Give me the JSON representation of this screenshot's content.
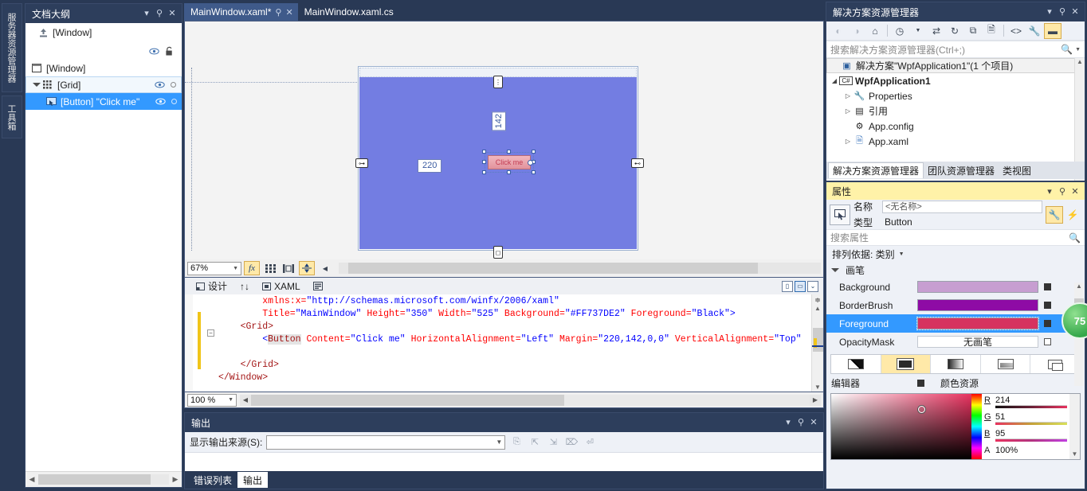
{
  "left_dock": {
    "tabs": [
      {
        "label": "服务器资源管理器",
        "name": "server-explorer"
      },
      {
        "label": "工具箱",
        "name": "toolbox"
      }
    ]
  },
  "document_outline": {
    "title": "文档大纲",
    "window_header": "[Window]",
    "rows": [
      {
        "label": "[Window]",
        "icon": "window-icon",
        "indent": 0
      },
      {
        "label": "[Grid]",
        "icon": "grid-icon",
        "indent": 1
      },
      {
        "label": "[Button] \"Click me\"",
        "icon": "button-icon",
        "indent": 2
      }
    ]
  },
  "editor_tabs": [
    {
      "label": "MainWindow.xaml*",
      "active": true,
      "dirty": true
    },
    {
      "label": "MainWindow.xaml.cs",
      "active": false,
      "dirty": false
    }
  ],
  "designer": {
    "zoom": "67%",
    "margin_left_chip": "220",
    "margin_top_chip": "142",
    "button_content": "Click me",
    "window_background": "#737DE2",
    "buttons": {
      "fx": "fx",
      "grid_rulers": "grid-icon",
      "snap": "snap-icon",
      "effects": "effects-icon"
    }
  },
  "split_bar": {
    "design_label": "设计",
    "swap_label": "swap-icon",
    "xaml_label": "XAML",
    "props_label": "props-icon"
  },
  "code": {
    "zoom": "100 %",
    "lines": [
      {
        "indent": 8,
        "parts": [
          {
            "t": "xmlns:x=",
            "c": "attr"
          },
          {
            "t": "\"http://schemas.microsoft.com/winfx/2006/xaml\"",
            "c": "val"
          }
        ]
      },
      {
        "indent": 8,
        "parts": [
          {
            "t": "Title=",
            "c": "attr"
          },
          {
            "t": "\"MainWindow\"",
            "c": "val"
          },
          {
            "t": " Height=",
            "c": "attr"
          },
          {
            "t": "\"350\"",
            "c": "val"
          },
          {
            "t": " Width=",
            "c": "attr"
          },
          {
            "t": "\"525\"",
            "c": "val"
          },
          {
            "t": " Background=",
            "c": "attr"
          },
          {
            "t": "\"#FF737DE2\"",
            "c": "val"
          },
          {
            "t": " Foreground=",
            "c": "attr"
          },
          {
            "t": "\"Black\"",
            "c": "val"
          },
          {
            "t": ">",
            "c": "brk"
          }
        ]
      },
      {
        "indent": 4,
        "parts": [
          {
            "t": "<Grid>",
            "c": "tag"
          }
        ]
      },
      {
        "indent": 8,
        "parts": [
          {
            "t": "<",
            "c": "brk"
          },
          {
            "t": "Button",
            "c": "el"
          },
          {
            "t": " Content=",
            "c": "attr"
          },
          {
            "t": "\"Click me\"",
            "c": "val"
          },
          {
            "t": " HorizontalAlignment=",
            "c": "attr"
          },
          {
            "t": "\"Left\"",
            "c": "val"
          },
          {
            "t": " Margin=",
            "c": "attr"
          },
          {
            "t": "\"220,142,0,0\"",
            "c": "val"
          },
          {
            "t": " VerticalAlignment=",
            "c": "attr"
          },
          {
            "t": "\"Top\"",
            "c": "val"
          }
        ]
      },
      {
        "indent": 0,
        "parts": []
      },
      {
        "indent": 4,
        "parts": [
          {
            "t": "</Grid>",
            "c": "tag"
          }
        ]
      },
      {
        "indent": 0,
        "parts": [
          {
            "t": "</Window>",
            "c": "tag"
          }
        ]
      }
    ]
  },
  "output_panel": {
    "title": "输出",
    "source_label": "显示输出来源(S):",
    "source_value": "",
    "tabs": [
      {
        "label": "错误列表",
        "active": false
      },
      {
        "label": "输出",
        "active": true
      }
    ]
  },
  "solution_explorer": {
    "title": "解决方案资源管理器",
    "search_placeholder": "搜索解决方案资源管理器(Ctrl+;)",
    "toolbar_icons": [
      "back-icon",
      "forward-icon",
      "home-icon",
      "pending-changes-icon",
      "sync-icon",
      "refresh-icon",
      "collapse-all-icon",
      "show-all-files-icon",
      "view-code-icon",
      "properties-icon",
      "preview-selected-icon"
    ],
    "tree": [
      {
        "label": "解决方案\"WpfApplication1\"(1 个项目)",
        "icon": "solution-icon",
        "indent": 0,
        "arrow": "",
        "bold": false,
        "selected": true
      },
      {
        "label": "WpfApplication1",
        "icon": "csharp-icon",
        "indent": 0,
        "arrow": "open",
        "bold": true,
        "selected": false
      },
      {
        "label": "Properties",
        "icon": "wrench-icon",
        "indent": 1,
        "arrow": "closed",
        "bold": false,
        "selected": false
      },
      {
        "label": "引用",
        "icon": "references-icon",
        "indent": 1,
        "arrow": "closed",
        "bold": false,
        "selected": false
      },
      {
        "label": "App.config",
        "icon": "config-icon",
        "indent": 1,
        "arrow": "",
        "bold": false,
        "selected": false
      },
      {
        "label": "App.xaml",
        "icon": "xaml-icon",
        "indent": 1,
        "arrow": "closed",
        "bold": false,
        "selected": false
      }
    ],
    "tabs": [
      {
        "label": "解决方案资源管理器",
        "active": true
      },
      {
        "label": "团队资源管理器",
        "active": false
      },
      {
        "label": "类视图",
        "active": false
      }
    ]
  },
  "properties": {
    "title": "属性",
    "name_label": "名称",
    "name_value": "<无名称>",
    "type_label": "类型",
    "type_value": "Button",
    "search_placeholder": "搜索属性",
    "sort_label": "排列依据: 类别",
    "category": "画笔",
    "rows": [
      {
        "name": "Background",
        "kind": "swatch",
        "color": "#c79ed1",
        "selected": false,
        "btn": "solid"
      },
      {
        "name": "BorderBrush",
        "kind": "swatch",
        "color": "#8e0ba5",
        "selected": false,
        "btn": "solid"
      },
      {
        "name": "Foreground",
        "kind": "swatch",
        "color": "#d6335f",
        "selected": true,
        "btn": "solid"
      },
      {
        "name": "OpacityMask",
        "kind": "empty",
        "value": "无画笔",
        "selected": false,
        "btn": "hollow"
      }
    ],
    "brush_tabs": [
      {
        "name": "no-brush",
        "active": false
      },
      {
        "name": "solid-brush",
        "active": true
      },
      {
        "name": "gradient-brush",
        "active": false
      },
      {
        "name": "tile-brush",
        "active": false
      },
      {
        "name": "brush-resource",
        "active": false
      }
    ],
    "editor_label": "编辑器",
    "resource_label": "颜色资源",
    "color": {
      "R_label": "R",
      "R": "214",
      "G_label": "G",
      "G": "51",
      "B_label": "B",
      "B": "95",
      "A_label": "A",
      "A": "100%"
    }
  },
  "watermark": {
    "text": "75"
  },
  "colors": {
    "chrome_dark": "#293955",
    "tab_active": "#3f5a8a",
    "selection_blue": "#3399ff",
    "properties_yellow": "#fff2a8",
    "designer_window_bg": "#737DE2"
  }
}
